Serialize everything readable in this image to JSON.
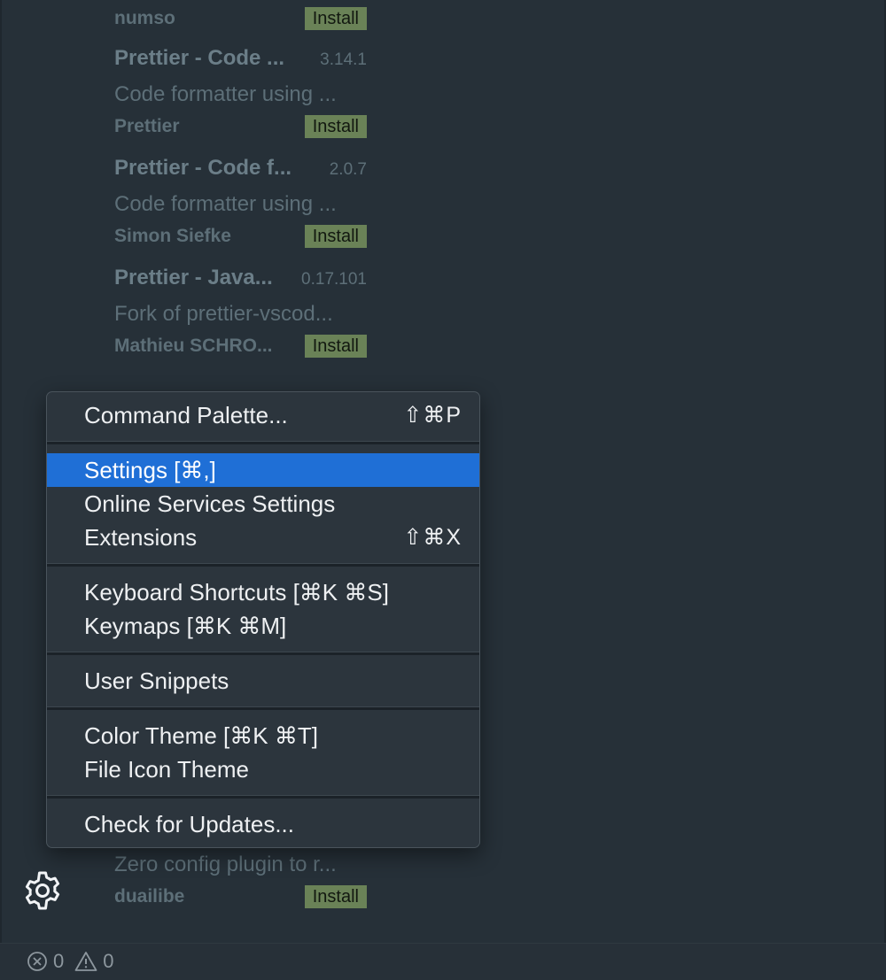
{
  "extensions": [
    {
      "name": "",
      "version": "",
      "description": "",
      "publisher": "numso",
      "action": "Install"
    },
    {
      "name": "Prettier - Code ...",
      "version": "3.14.1",
      "description": "Code formatter using ...",
      "publisher": "Prettier",
      "action": "Install"
    },
    {
      "name": "Prettier - Code f...",
      "version": "2.0.7",
      "description": "Code formatter using ...",
      "publisher": "Simon Siefke",
      "action": "Install"
    },
    {
      "name": "Prettier - Java...",
      "version": "0.17.101",
      "description": "Fork of prettier-vscod...",
      "publisher": "Mathieu SCHRO...",
      "action": "Install"
    },
    {
      "name": "",
      "version": "",
      "description": "Zero config plugin to r...",
      "publisher": "duailibe",
      "action": "Install"
    }
  ],
  "menu": {
    "items": [
      {
        "label": "Command Palette...",
        "shortcut": "⇧⌘P"
      },
      {
        "label": "Settings [⌘,]",
        "shortcut": ""
      },
      {
        "label": "Online Services Settings",
        "shortcut": ""
      },
      {
        "label": "Extensions",
        "shortcut": "⇧⌘X"
      },
      {
        "label": "Keyboard Shortcuts [⌘K ⌘S]",
        "shortcut": ""
      },
      {
        "label": "Keymaps [⌘K ⌘M]",
        "shortcut": ""
      },
      {
        "label": "User Snippets",
        "shortcut": ""
      },
      {
        "label": "Color Theme [⌘K ⌘T]",
        "shortcut": ""
      },
      {
        "label": "File Icon Theme",
        "shortcut": ""
      },
      {
        "label": "Check for Updates...",
        "shortcut": ""
      }
    ],
    "selected": "Settings [⌘,]"
  },
  "gear": {
    "icon": "gear-icon"
  },
  "status": {
    "errors": "0",
    "warnings": "0"
  },
  "colors": {
    "accent": "#1f6fd6",
    "install": "#6a8257",
    "background": "#263038"
  }
}
